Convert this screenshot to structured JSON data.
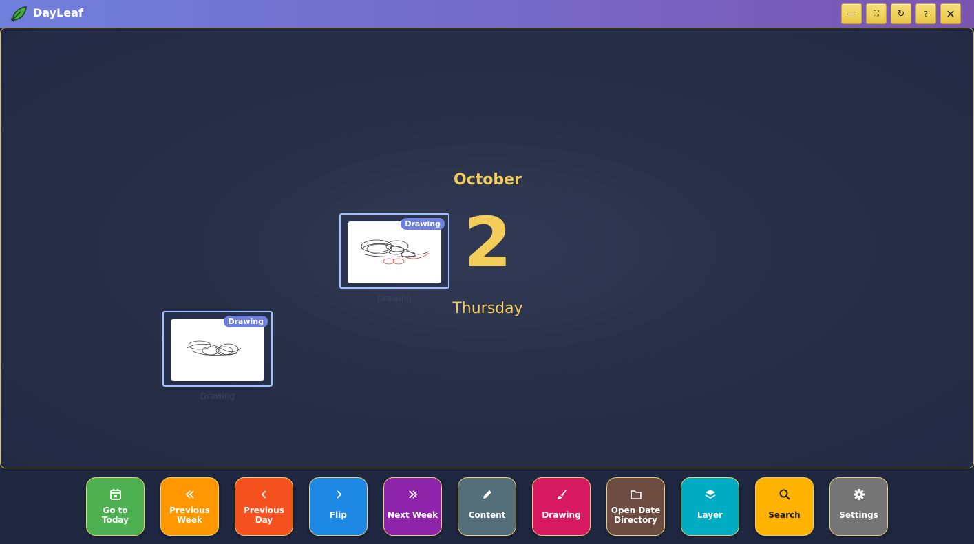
{
  "app": {
    "title": "DayLeaf",
    "logo_icon": "leaf-icon"
  },
  "window_controls": [
    {
      "name": "minimize",
      "glyph": "—"
    },
    {
      "name": "fullscreen",
      "glyph": "⛶"
    },
    {
      "name": "refresh",
      "glyph": "↻"
    },
    {
      "name": "help",
      "glyph": "?"
    },
    {
      "name": "close",
      "glyph": "✕"
    }
  ],
  "date": {
    "month": "October",
    "day": "2",
    "weekday": "Thursday"
  },
  "thumbnails": [
    {
      "badge": "Drawing",
      "caption": "Drawing"
    },
    {
      "badge": "Drawing",
      "caption": "Drawing"
    }
  ],
  "toolbar": [
    {
      "label": "Go to Today",
      "icon": "calendar-icon",
      "color": "#4caf50"
    },
    {
      "label": "Previous Week",
      "icon": "double-chevron-left-icon",
      "color": "#ff9800"
    },
    {
      "label": "Previous Day",
      "icon": "chevron-left-icon",
      "color": "#f4511e"
    },
    {
      "label": "Flip",
      "icon": "chevron-right-icon",
      "color": "#1e88e5"
    },
    {
      "label": "Next Week",
      "icon": "double-chevron-right-icon",
      "color": "#8e24aa"
    },
    {
      "label": "Content",
      "icon": "pencil-icon",
      "color": "#546e7a"
    },
    {
      "label": "Drawing",
      "icon": "brush-icon",
      "color": "#d81b60"
    },
    {
      "label": "Open Date Directory",
      "icon": "folder-icon",
      "color": "#6d4c41"
    },
    {
      "label": "Layer",
      "icon": "layers-icon",
      "color": "#00acc1"
    },
    {
      "label": "Search",
      "icon": "search-icon",
      "color": "#ffb300"
    },
    {
      "label": "Settings",
      "icon": "gear-icon",
      "color": "#757575"
    }
  ],
  "colors": {
    "accent": "#f3cd59",
    "badge": "#6f7fe0",
    "frame": "#d8c25a"
  }
}
